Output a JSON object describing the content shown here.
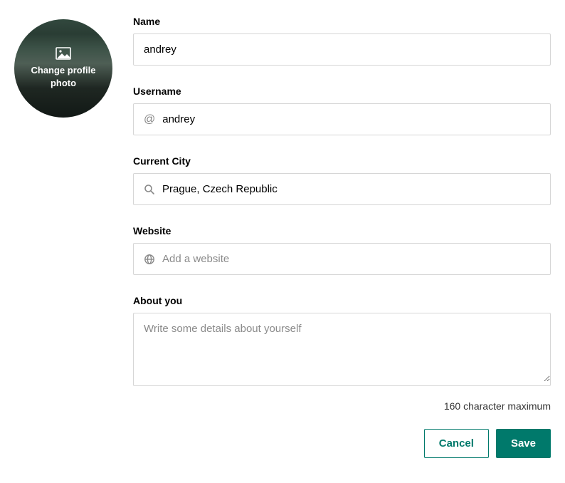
{
  "avatar": {
    "change_label": "Change profile photo"
  },
  "fields": {
    "name": {
      "label": "Name",
      "value": "andrey"
    },
    "username": {
      "label": "Username",
      "prefix": "@",
      "value": "andrey"
    },
    "city": {
      "label": "Current City",
      "value": "Prague, Czech Republic"
    },
    "website": {
      "label": "Website",
      "placeholder": "Add a website",
      "value": ""
    },
    "about": {
      "label": "About you",
      "placeholder": "Write some details about yourself",
      "value": "",
      "helper": "160 character maximum"
    }
  },
  "buttons": {
    "cancel": "Cancel",
    "save": "Save"
  }
}
